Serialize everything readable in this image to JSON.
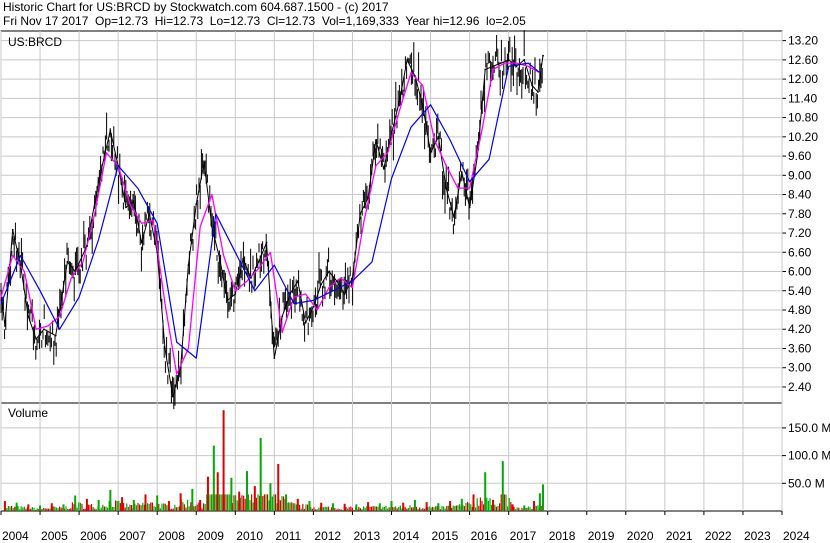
{
  "header": {
    "title": "Historic Chart for US:BRCD by Stockwatch.com 604.687.1500 - (c) 2017",
    "stats": "Fri Nov 17 2017  Op=12.73  Hi=12.73  Lo=12.73  Cl=12.73  Vol=1,169,333  Year hi=12.96  lo=2.05"
  },
  "colors": {
    "price": "#000000",
    "ma_short": "#ff00ff",
    "ma_long": "#0000ff",
    "vol_up": "#00aa00",
    "vol_down": "#dd0000",
    "grid": "#c8c8c8"
  },
  "chart_data": [
    {
      "type": "line",
      "title": "US:BRCD",
      "y_ticks": [
        "13.20",
        "12.60",
        "12.00",
        "11.40",
        "10.80",
        "10.20",
        "9.60",
        "9.00",
        "8.40",
        "7.80",
        "7.20",
        "6.60",
        "6.00",
        "5.40",
        "4.80",
        "4.20",
        "3.60",
        "3.00",
        "2.40"
      ],
      "ylim": [
        1.9,
        13.5
      ],
      "x_ticks": [
        "2004",
        "2005",
        "2006",
        "2007",
        "2008",
        "2009",
        "2010",
        "2011",
        "2012",
        "2013",
        "2014",
        "2015",
        "2016",
        "2017",
        "2018",
        "2019",
        "2020",
        "2021",
        "2022",
        "2023",
        "2024"
      ],
      "xlim": [
        2004.0,
        2024.0
      ],
      "grid": true,
      "series": [
        {
          "role": "close",
          "x": [
            2004.0,
            2004.1,
            2004.3,
            2004.5,
            2004.7,
            2004.9,
            2005.1,
            2005.4,
            2005.7,
            2005.9,
            2006.2,
            2006.5,
            2006.8,
            2007.0,
            2007.2,
            2007.4,
            2007.6,
            2007.8,
            2008.0,
            2008.2,
            2008.4,
            2008.6,
            2008.8,
            2009.0,
            2009.2,
            2009.4,
            2009.6,
            2009.8,
            2010.0,
            2010.2,
            2010.4,
            2010.6,
            2010.8,
            2011.0,
            2011.2,
            2011.4,
            2011.6,
            2011.8,
            2012.0,
            2012.2,
            2012.4,
            2012.6,
            2012.8,
            2013.0,
            2013.2,
            2013.4,
            2013.6,
            2013.8,
            2014.0,
            2014.2,
            2014.4,
            2014.6,
            2014.8,
            2015.0,
            2015.2,
            2015.4,
            2015.6,
            2015.8,
            2016.0,
            2016.2,
            2016.4,
            2016.6,
            2016.8,
            2017.0,
            2017.2,
            2017.4,
            2017.6,
            2017.75,
            2017.88
          ],
          "y": [
            5.4,
            4.3,
            7.3,
            6.2,
            4.6,
            3.9,
            4.2,
            4.0,
            6.3,
            6.0,
            6.8,
            8.8,
            10.4,
            9.3,
            8.0,
            8.2,
            6.9,
            7.8,
            6.6,
            3.6,
            2.1,
            3.0,
            6.2,
            8.1,
            9.4,
            7.4,
            6.4,
            5.1,
            5.3,
            6.4,
            5.8,
            6.3,
            6.9,
            3.3,
            4.6,
            5.3,
            5.7,
            4.4,
            4.9,
            5.6,
            6.0,
            5.7,
            5.3,
            5.8,
            7.8,
            8.3,
            10.1,
            9.2,
            10.3,
            11.3,
            12.6,
            12.1,
            11.2,
            9.7,
            10.2,
            8.6,
            7.7,
            9.1,
            8.0,
            9.6,
            12.3,
            12.4,
            12.5,
            12.6,
            12.4,
            12.6,
            11.8,
            11.6,
            12.73
          ]
        },
        {
          "role": "ma_short",
          "x": [
            2004.0,
            2004.3,
            2004.6,
            2004.9,
            2005.2,
            2005.5,
            2005.8,
            2006.1,
            2006.4,
            2006.7,
            2007.0,
            2007.3,
            2007.6,
            2007.9,
            2008.2,
            2008.5,
            2008.8,
            2009.1,
            2009.4,
            2009.7,
            2010.0,
            2010.3,
            2010.6,
            2010.9,
            2011.2,
            2011.5,
            2011.8,
            2012.1,
            2012.4,
            2012.7,
            2013.0,
            2013.3,
            2013.6,
            2013.9,
            2014.2,
            2014.5,
            2014.8,
            2015.1,
            2015.4,
            2015.7,
            2016.0,
            2016.3,
            2016.6,
            2016.9,
            2017.2,
            2017.5,
            2017.8
          ],
          "y": [
            5.2,
            6.5,
            6.0,
            4.2,
            4.3,
            4.6,
            5.8,
            6.3,
            7.8,
            9.7,
            9.3,
            8.1,
            7.5,
            7.6,
            5.0,
            2.8,
            3.6,
            7.4,
            8.4,
            6.5,
            5.4,
            5.7,
            6.1,
            6.6,
            4.1,
            5.2,
            5.3,
            4.8,
            5.5,
            5.8,
            5.5,
            7.6,
            9.3,
            9.7,
            11.0,
            12.2,
            11.8,
            10.1,
            9.3,
            8.6,
            8.6,
            10.3,
            12.3,
            12.5,
            12.5,
            12.4,
            12.2
          ]
        },
        {
          "role": "ma_long",
          "x": [
            2004.0,
            2004.5,
            2005.0,
            2005.5,
            2006.0,
            2006.5,
            2007.0,
            2007.5,
            2008.0,
            2008.5,
            2009.0,
            2009.5,
            2010.0,
            2010.5,
            2011.0,
            2011.5,
            2012.0,
            2012.5,
            2013.0,
            2013.5,
            2014.0,
            2014.5,
            2015.0,
            2015.5,
            2016.0,
            2016.5,
            2017.0,
            2017.5,
            2017.8
          ],
          "y": [
            5.0,
            6.5,
            5.4,
            4.2,
            5.2,
            7.0,
            9.3,
            8.6,
            7.5,
            3.8,
            3.3,
            7.8,
            6.6,
            5.4,
            6.2,
            5.0,
            5.1,
            5.4,
            5.7,
            6.3,
            8.9,
            10.5,
            11.2,
            10.1,
            8.8,
            9.5,
            12.4,
            12.5,
            12.2
          ]
        }
      ]
    },
    {
      "type": "bar",
      "title": "Volume",
      "y_ticks": [
        "150.0 M",
        "100.0 M",
        "50.0 M"
      ],
      "ylim": [
        0,
        195
      ],
      "unit": "M",
      "bars": [
        {
          "x": 2004.1,
          "v": 18,
          "dir": "down"
        },
        {
          "x": 2004.4,
          "v": 15,
          "dir": "up"
        },
        {
          "x": 2004.7,
          "v": 12,
          "dir": "down"
        },
        {
          "x": 2005.0,
          "v": 10,
          "dir": "up"
        },
        {
          "x": 2005.3,
          "v": 14,
          "dir": "down"
        },
        {
          "x": 2005.6,
          "v": 12,
          "dir": "up"
        },
        {
          "x": 2005.9,
          "v": 28,
          "dir": "up"
        },
        {
          "x": 2006.2,
          "v": 22,
          "dir": "down"
        },
        {
          "x": 2006.5,
          "v": 20,
          "dir": "up"
        },
        {
          "x": 2006.8,
          "v": 38,
          "dir": "up"
        },
        {
          "x": 2007.1,
          "v": 25,
          "dir": "down"
        },
        {
          "x": 2007.4,
          "v": 20,
          "dir": "up"
        },
        {
          "x": 2007.7,
          "v": 30,
          "dir": "down"
        },
        {
          "x": 2008.0,
          "v": 28,
          "dir": "up"
        },
        {
          "x": 2008.3,
          "v": 18,
          "dir": "down"
        },
        {
          "x": 2008.6,
          "v": 32,
          "dir": "down"
        },
        {
          "x": 2008.9,
          "v": 40,
          "dir": "up"
        },
        {
          "x": 2009.1,
          "v": 20,
          "dir": "down"
        },
        {
          "x": 2009.3,
          "v": 62,
          "dir": "down"
        },
        {
          "x": 2009.45,
          "v": 118,
          "dir": "up"
        },
        {
          "x": 2009.55,
          "v": 70,
          "dir": "down"
        },
        {
          "x": 2009.7,
          "v": 182,
          "dir": "down"
        },
        {
          "x": 2009.9,
          "v": 60,
          "dir": "up"
        },
        {
          "x": 2010.1,
          "v": 35,
          "dir": "down"
        },
        {
          "x": 2010.3,
          "v": 72,
          "dir": "up"
        },
        {
          "x": 2010.5,
          "v": 45,
          "dir": "down"
        },
        {
          "x": 2010.65,
          "v": 132,
          "dir": "up"
        },
        {
          "x": 2010.9,
          "v": 50,
          "dir": "up"
        },
        {
          "x": 2011.1,
          "v": 85,
          "dir": "down"
        },
        {
          "x": 2011.3,
          "v": 30,
          "dir": "up"
        },
        {
          "x": 2011.6,
          "v": 22,
          "dir": "down"
        },
        {
          "x": 2011.9,
          "v": 18,
          "dir": "up"
        },
        {
          "x": 2012.2,
          "v": 15,
          "dir": "down"
        },
        {
          "x": 2012.5,
          "v": 14,
          "dir": "up"
        },
        {
          "x": 2012.8,
          "v": 13,
          "dir": "down"
        },
        {
          "x": 2013.1,
          "v": 12,
          "dir": "up"
        },
        {
          "x": 2013.4,
          "v": 16,
          "dir": "down"
        },
        {
          "x": 2013.7,
          "v": 14,
          "dir": "up"
        },
        {
          "x": 2014.0,
          "v": 18,
          "dir": "up"
        },
        {
          "x": 2014.3,
          "v": 15,
          "dir": "down"
        },
        {
          "x": 2014.6,
          "v": 20,
          "dir": "up"
        },
        {
          "x": 2014.9,
          "v": 16,
          "dir": "down"
        },
        {
          "x": 2015.2,
          "v": 14,
          "dir": "up"
        },
        {
          "x": 2015.5,
          "v": 18,
          "dir": "down"
        },
        {
          "x": 2015.8,
          "v": 22,
          "dir": "up"
        },
        {
          "x": 2016.1,
          "v": 30,
          "dir": "down"
        },
        {
          "x": 2016.4,
          "v": 70,
          "dir": "up"
        },
        {
          "x": 2016.6,
          "v": 20,
          "dir": "down"
        },
        {
          "x": 2016.85,
          "v": 90,
          "dir": "up"
        },
        {
          "x": 2017.1,
          "v": 12,
          "dir": "down"
        },
        {
          "x": 2017.4,
          "v": 10,
          "dir": "up"
        },
        {
          "x": 2017.65,
          "v": 18,
          "dir": "down"
        },
        {
          "x": 2017.8,
          "v": 32,
          "dir": "up"
        },
        {
          "x": 2017.88,
          "v": 48,
          "dir": "up"
        }
      ]
    }
  ]
}
